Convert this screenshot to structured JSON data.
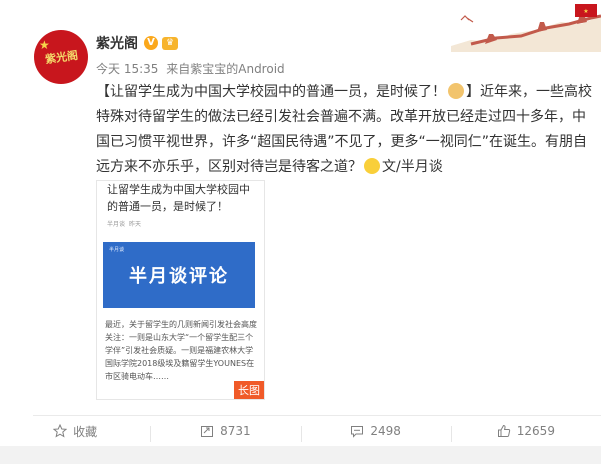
{
  "post": {
    "author": "紫光阁",
    "time": "今天 15:35",
    "via_prefix": "来自",
    "via": "紫宝宝的Android",
    "content": "【让留学生成为中国大学校园中的普通一员，是时候了！",
    "content_2": "】近年来，一些高校特殊对待留学生的做法已经引发社会普遍不满。改革开放已经走过四十多年，中国已习惯平视世界，许多“超国民待遇”不见了，更多“一视同仁”在诞生。有朋自远方来不亦乐乎，区别对待岂是待客之道？",
    "content_3": "文/半月谈"
  },
  "avatar": {
    "text": "紫光阁"
  },
  "thumbnail": {
    "title": "让留学生成为中国大学校园中的普通一员，是时候了！",
    "byline_source": "半月谈",
    "byline_time": "昨天",
    "banner_brand": "半月谈",
    "banner_title": "半月谈评论",
    "body": "最近，关于留学生的几则新闻引发社会高度关注：一则是山东大学“一个留学生配三个学伴”引发社会质疑。一则是福建农林大学国际学院2018级埃及籍留学生YOUNES在市区骑电动车……",
    "badge": "长图"
  },
  "actions": {
    "favorite": "收藏",
    "repost": "8731",
    "comment": "2498",
    "like": "12659"
  },
  "colors": {
    "avatar_red": "#c8161d",
    "banner_blue": "#2f6cc8",
    "badge_orange": "#f05a28"
  }
}
